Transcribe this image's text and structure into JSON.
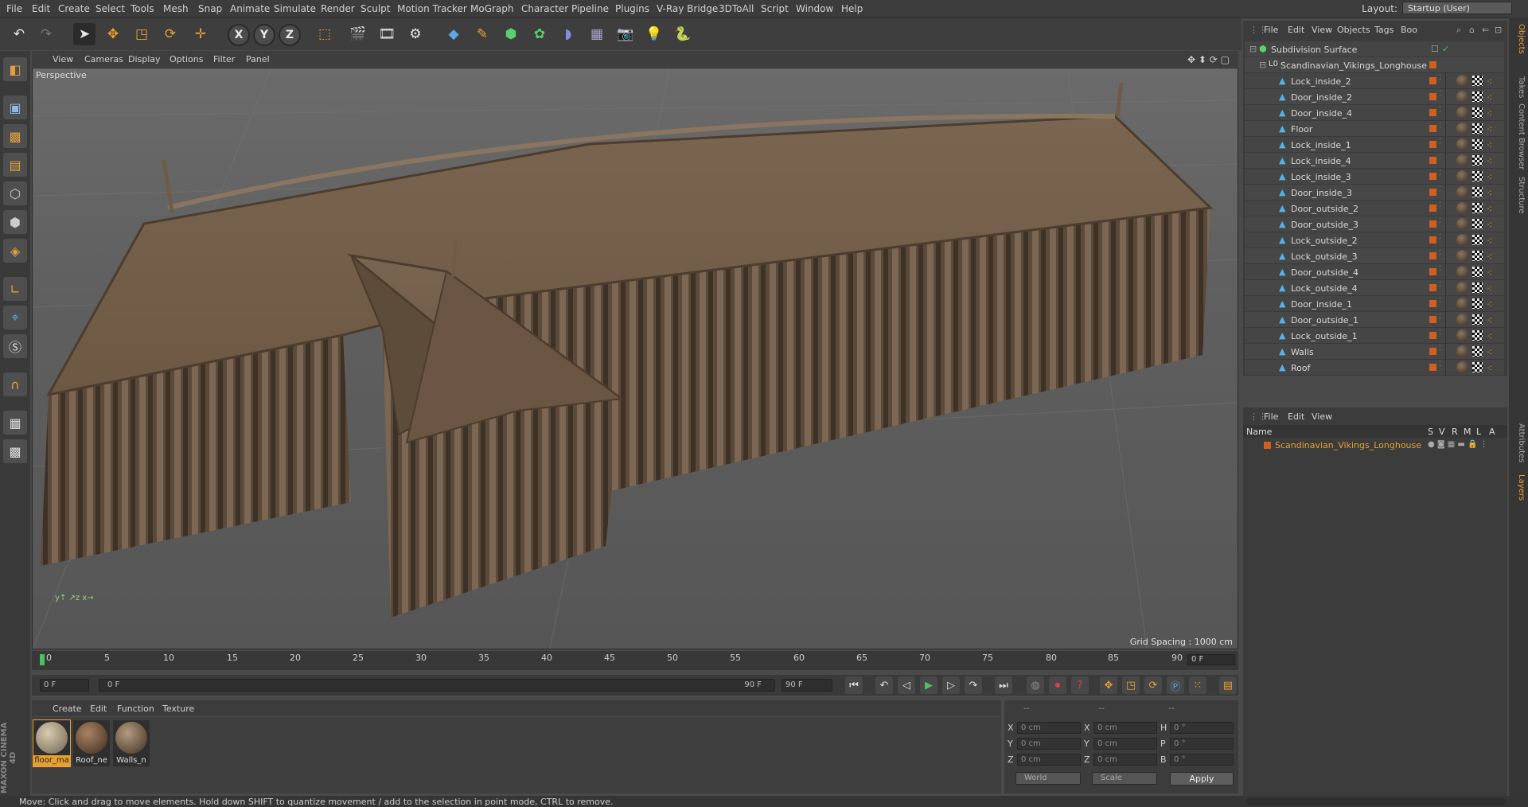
{
  "menu": [
    "File",
    "Edit",
    "Create",
    "Select",
    "Tools",
    "Mesh",
    "Snap",
    "Animate",
    "Simulate",
    "Render",
    "Sculpt",
    "Motion Tracker",
    "MoGraph",
    "Character",
    "Pipeline",
    "Plugins",
    "V-Ray Bridge",
    "3DToAll",
    "Script",
    "Window",
    "Help"
  ],
  "layout": {
    "label": "Layout:",
    "value": "Startup (User)"
  },
  "toolbar": {
    "axis_x": "X",
    "axis_y": "Y",
    "axis_z": "Z"
  },
  "viewport": {
    "menu": [
      "View",
      "Cameras",
      "Display",
      "Options",
      "Filter",
      "Panel"
    ],
    "title": "Perspective",
    "grid_spacing": "Grid Spacing : 1000 cm"
  },
  "timeline": {
    "ticks": [
      "0",
      "5",
      "10",
      "15",
      "20",
      "25",
      "30",
      "35",
      "40",
      "45",
      "50",
      "55",
      "60",
      "65",
      "70",
      "75",
      "80",
      "85",
      "90"
    ],
    "current_frame_right": "0 F"
  },
  "transport": {
    "start": "0 F",
    "slider_left": "0 F",
    "slider_right": "90 F",
    "end": "90 F"
  },
  "materials": {
    "menu": [
      "Create",
      "Edit",
      "Function",
      "Texture"
    ],
    "items": [
      {
        "name": "floor_ma",
        "color": "#b9aa8e"
      },
      {
        "name": "Roof_ne",
        "color": "#7d5f45"
      },
      {
        "name": "Walls_n",
        "color": "#8c7058"
      }
    ]
  },
  "coords": {
    "header1": "--",
    "header2": "--",
    "header3": "--",
    "rows": [
      {
        "a": "X",
        "av": "0 cm",
        "b": "X",
        "bv": "0 cm",
        "c": "H",
        "cv": "0 °"
      },
      {
        "a": "Y",
        "av": "0 cm",
        "b": "Y",
        "bv": "0 cm",
        "c": "P",
        "cv": "0 °"
      },
      {
        "a": "Z",
        "av": "0 cm",
        "b": "Z",
        "bv": "0 cm",
        "c": "B",
        "cv": "0 °"
      }
    ],
    "mode": "World",
    "scale": "Scale",
    "apply": "Apply"
  },
  "status": "Move: Click and drag to move elements. Hold down SHIFT to quantize movement / add to the selection in point mode, CTRL to remove.",
  "objects": {
    "menu": [
      "File",
      "Edit",
      "View",
      "Objects",
      "Tags",
      "Boo"
    ],
    "root": "Subdivision Surface",
    "group": "Scandinavian_Vikings_Longhouse",
    "items": [
      "Lock_inside_2",
      "Door_inside_2",
      "Door_inside_4",
      "Floor",
      "Lock_inside_1",
      "Lock_inside_4",
      "Lock_inside_3",
      "Door_inside_3",
      "Door_outside_2",
      "Door_outside_3",
      "Lock_outside_2",
      "Lock_outside_3",
      "Door_outside_4",
      "Lock_outside_4",
      "Door_inside_1",
      "Door_outside_1",
      "Lock_outside_1",
      "Walls",
      "Roof"
    ]
  },
  "layers": {
    "menu": [
      "File",
      "Edit",
      "View"
    ],
    "headers": {
      "name": "Name",
      "s": "S",
      "v": "V",
      "r": "R",
      "m": "M",
      "l": "L",
      "a": "A"
    },
    "items": [
      "Scandinavian_Vikings_Longhouse"
    ]
  },
  "sidetabs": [
    "Objects",
    "Takes",
    "Content Browser",
    "Structure",
    "Attributes",
    "Layers"
  ],
  "brand": {
    "maxon": "MAXON",
    "cinema": "CINEMA 4D"
  }
}
